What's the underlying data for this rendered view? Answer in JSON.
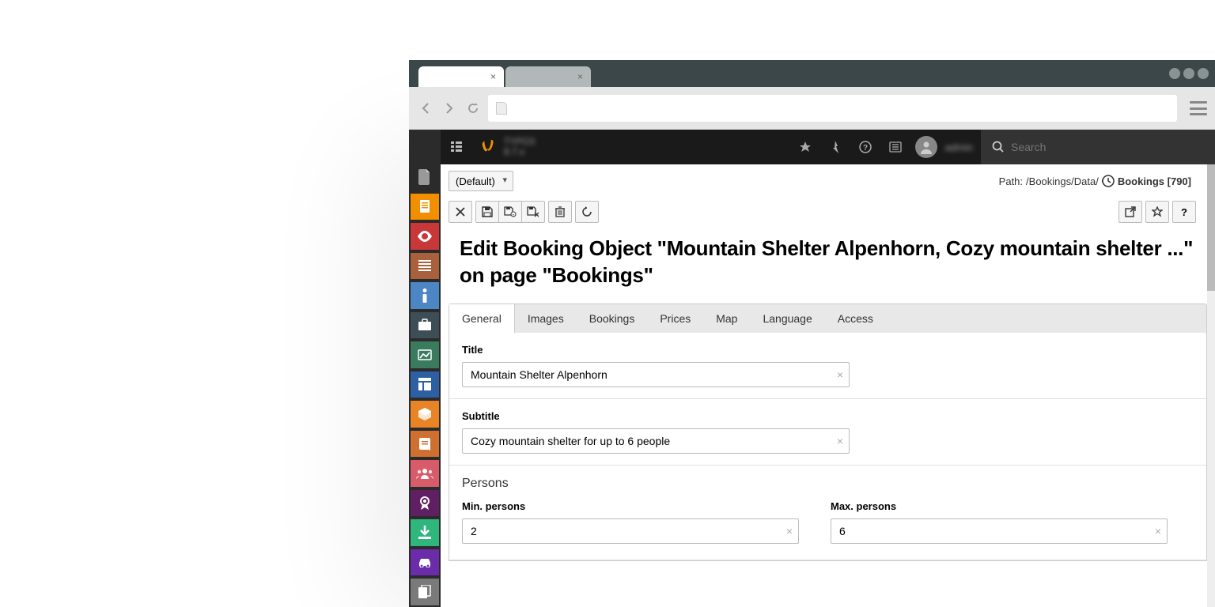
{
  "browser": {
    "tab1_close": "×",
    "tab2_close": "×"
  },
  "topbar": {
    "search_placeholder": "Search"
  },
  "path": {
    "prefix": "Path: ",
    "value": "/Bookings/Data/",
    "current": "Bookings [790]"
  },
  "lang_select": "(Default)",
  "page_title": "Edit Booking Object \"Mountain Shelter Alpenhorn, Cozy mountain shelter ...\" on page \"Bookings\"",
  "tabs": {
    "general": "General",
    "images": "Images",
    "bookings": "Bookings",
    "prices": "Prices",
    "map": "Map",
    "language": "Language",
    "access": "Access"
  },
  "form": {
    "title_label": "Title",
    "title_value": "Mountain Shelter Alpenhorn",
    "subtitle_label": "Subtitle",
    "subtitle_value": "Cozy mountain shelter for up to 6 people",
    "persons_heading": "Persons",
    "min_label": "Min. persons",
    "min_value": "2",
    "max_label": "Max. persons",
    "max_value": "6"
  },
  "module_icons": [
    "file",
    "page",
    "view",
    "list",
    "info",
    "workspace",
    "template",
    "layout",
    "package",
    "book",
    "users",
    "badge",
    "download",
    "car",
    "copy"
  ]
}
